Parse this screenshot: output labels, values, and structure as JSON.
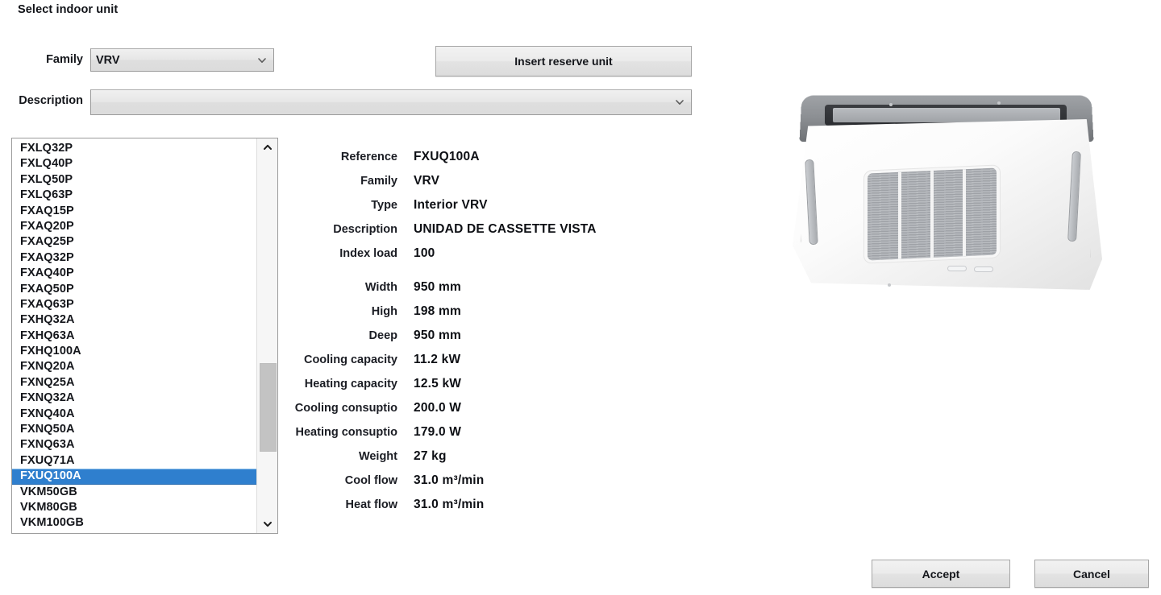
{
  "dialog": {
    "title": "Select indoor unit"
  },
  "form": {
    "family": {
      "label": "Family",
      "value": "VRV",
      "icon": "chevron-down-icon"
    },
    "description": {
      "label": "Description",
      "value": "",
      "placeholder": "",
      "icon": "chevron-down-icon"
    },
    "insert_reserve_button": "Insert reserve unit"
  },
  "list": {
    "items": [
      "FXLQ32P",
      "FXLQ40P",
      "FXLQ50P",
      "FXLQ63P",
      "FXAQ15P",
      "FXAQ20P",
      "FXAQ25P",
      "FXAQ32P",
      "FXAQ40P",
      "FXAQ50P",
      "FXAQ63P",
      "FXHQ32A",
      "FXHQ63A",
      "FXHQ100A",
      "FXNQ20A",
      "FXNQ25A",
      "FXNQ32A",
      "FXNQ40A",
      "FXNQ50A",
      "FXNQ63A",
      "FXUQ71A",
      "FXUQ100A",
      "VKM50GB",
      "VKM80GB",
      "VKM100GB"
    ],
    "selected": "FXUQ100A",
    "selected_index": 21,
    "scroll_up_icon": "chevron-up-icon",
    "scroll_down_icon": "chevron-down-icon",
    "highlight_color": "#2f7fce"
  },
  "details": {
    "rows": [
      {
        "label": "Reference",
        "value": "FXUQ100A"
      },
      {
        "label": "Family",
        "value": "VRV"
      },
      {
        "label": "Type",
        "value": "Interior VRV"
      },
      {
        "label": "Description",
        "value": "UNIDAD DE CASSETTE VISTA"
      },
      {
        "label": "Index load",
        "value": "100"
      },
      {
        "label": "Width",
        "value": "950 mm"
      },
      {
        "label": "High",
        "value": "198 mm"
      },
      {
        "label": "Deep",
        "value": "950 mm"
      },
      {
        "label": "Cooling capacity",
        "value": "11.2 kW"
      },
      {
        "label": "Heating capacity",
        "value": "12.5 kW"
      },
      {
        "label": "Cooling consuptio",
        "value": "200.0 W"
      },
      {
        "label": "Heating consuptio",
        "value": "179.0 W"
      },
      {
        "label": "Weight",
        "value": "27 kg"
      },
      {
        "label": "Cool flow",
        "value": "31.0 m³/min"
      },
      {
        "label": "Heat flow",
        "value": "31.0 m³/min"
      }
    ]
  },
  "preview": {
    "image_name": "ceiling-cassette-unit-photo"
  },
  "footer": {
    "accept": "Accept",
    "cancel": "Cancel"
  }
}
